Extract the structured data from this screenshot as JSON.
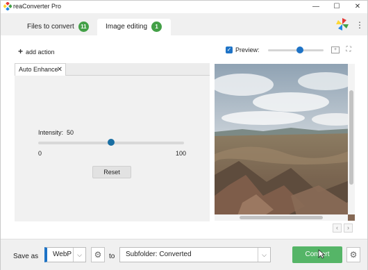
{
  "app": {
    "title": "reaConverter Pro"
  },
  "window_controls": {
    "minimize": "—",
    "maximize": "☐",
    "close": "✕"
  },
  "tabs": [
    {
      "label": "Files to convert",
      "count": "11"
    },
    {
      "label": "Image editing",
      "count": "1"
    }
  ],
  "toolbar": {
    "add_action": "add action",
    "preview_label": "Preview:",
    "preview_checked": true,
    "preview_zoom": 0.58
  },
  "action_panel": {
    "tab_label": "Auto Enhance",
    "intensity_label": "Intensity:",
    "intensity_value": "50",
    "min_label": "0",
    "max_label": "100",
    "reset_label": "Reset",
    "intensity_fraction": 0.5
  },
  "bottom": {
    "save_as_label": "Save as",
    "format_value": "WebP",
    "to_label": "to",
    "destination_value": "Subfolder: Converted",
    "convert_label": "Convert"
  },
  "colors": {
    "accent_blue": "#1e73c6",
    "badge_green": "#43a047",
    "convert_green": "#55b567"
  }
}
